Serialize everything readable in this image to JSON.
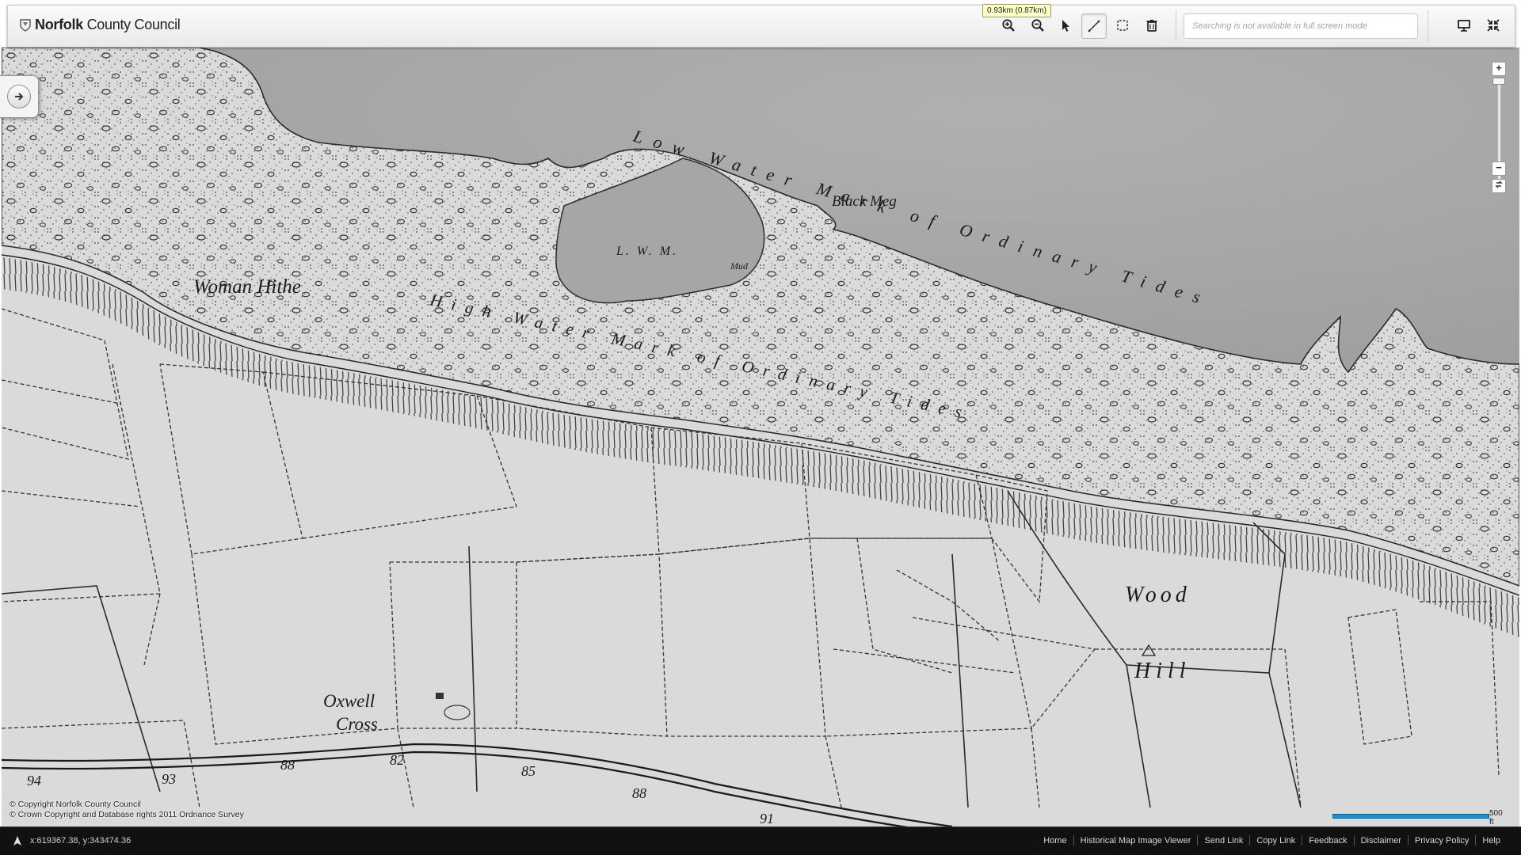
{
  "header": {
    "logo_bold": "Norfolk",
    "logo_rest": " County Council",
    "tooltip": "0.93km (0.87km)",
    "search_placeholder": "Searching is not available in full screen mode"
  },
  "toolbar": {
    "tools": [
      {
        "name": "zoom-in-icon",
        "active": false
      },
      {
        "name": "zoom-out-icon",
        "active": false
      },
      {
        "name": "pointer-icon",
        "active": false
      },
      {
        "name": "measure-line-icon",
        "active": true
      },
      {
        "name": "select-area-icon",
        "active": false
      },
      {
        "name": "delete-icon",
        "active": false
      },
      {
        "name": "print-icon",
        "active": false
      },
      {
        "name": "exit-fullscreen-icon",
        "active": false
      }
    ]
  },
  "map": {
    "labels": {
      "low_water": "Low Water Mark of Ordinary Tides",
      "black_meg": "Black Meg",
      "lwm": "L. W. M.",
      "mud": "Mud",
      "woman_hithe": "Woman Hithe",
      "high_water": "High Water Mark of Ordinary Tides",
      "wood": "Wood",
      "hill": "Hill",
      "oxwell": "Oxwell",
      "cross": "Cross"
    },
    "spot_heights": [
      "94",
      "93",
      "88",
      "82",
      "85",
      "88",
      "91"
    ],
    "zoom": {
      "plus": "+",
      "minus": "−"
    }
  },
  "attribution": {
    "line1": "© Copyright Norfolk County Council",
    "line2": "© Crown Copyright and Database rights 2011 Ordnance Survey"
  },
  "scale": {
    "label": "500 ft"
  },
  "footer": {
    "coords": "x:619367.38, y:343474.36",
    "links": [
      "Home",
      "Historical Map Image Viewer",
      "Send Link",
      "Copy Link",
      "Feedback",
      "Disclaimer",
      "Privacy Policy",
      "Help"
    ]
  },
  "colors": {
    "sea": "#a9a9a9",
    "land": "#d9d9d9",
    "ink": "#1b1b1b",
    "scale": "#1e8fd6",
    "footer": "#111111"
  }
}
